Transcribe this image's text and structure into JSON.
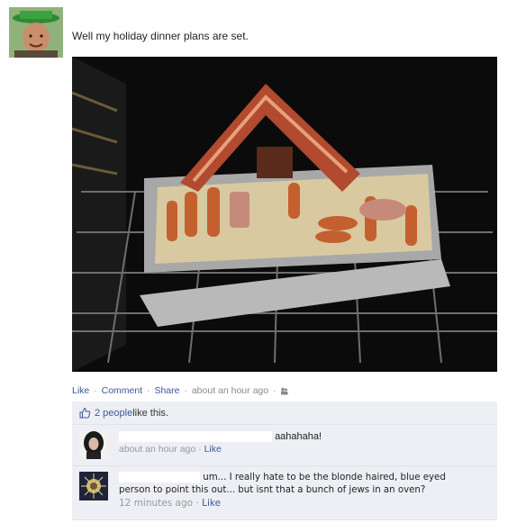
{
  "post": {
    "status": "Well my holiday dinner plans are set.",
    "photo_alt": "oven photo"
  },
  "actions": {
    "like": "Like",
    "comment": "Comment",
    "share": "Share",
    "timestamp": "about an hour ago",
    "sep": "·"
  },
  "likes": {
    "count": "2 people",
    "suffix": " like this."
  },
  "comments": [
    {
      "text": "aahahaha!",
      "time": "about an hour ago",
      "like": "Like"
    },
    {
      "text_line1": "um... I really hate to be the blonde haired, blue eyed",
      "text_line2": "person to point this out... but isnt that a bunch of jews in an oven?",
      "time": "12 minutes ago",
      "like": "Like"
    }
  ],
  "colors": {
    "link": "#3b5998",
    "feedback_bg": "#edeff4"
  }
}
